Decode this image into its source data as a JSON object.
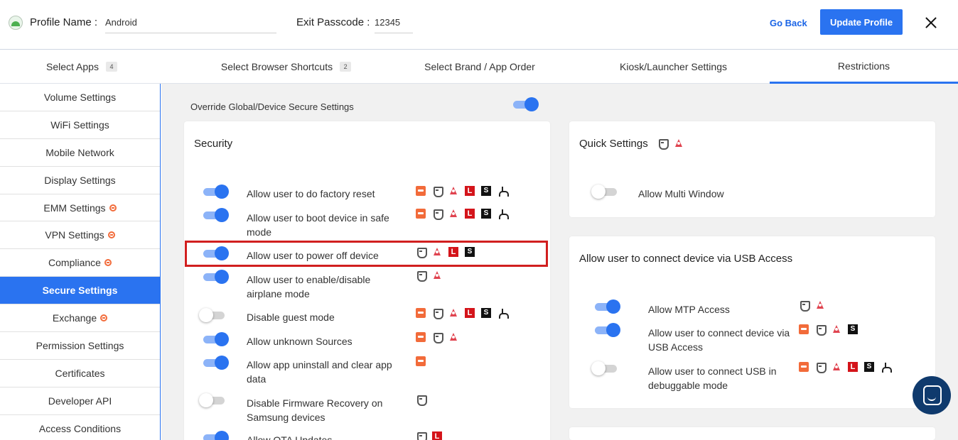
{
  "header": {
    "profile_label": "Profile Name",
    "profile_value": "Android",
    "exit_label": "Exit Passcode",
    "exit_value": "12345",
    "go_back": "Go Back",
    "update_button": "Update Profile"
  },
  "tabs": [
    {
      "label": "Select Apps",
      "count": "4"
    },
    {
      "label": "Select Browser Shortcuts",
      "count": "2"
    },
    {
      "label": "Select Brand / App Order"
    },
    {
      "label": "Kiosk/Launcher Settings"
    },
    {
      "label": "Restrictions",
      "active": true
    }
  ],
  "sidebar": {
    "items": [
      {
        "label": "Volume Settings"
      },
      {
        "label": "WiFi Settings"
      },
      {
        "label": "Mobile Network"
      },
      {
        "label": "Display Settings"
      },
      {
        "label": "EMM Settings",
        "badge": true
      },
      {
        "label": "VPN Settings",
        "badge": true
      },
      {
        "label": "Compliance",
        "badge": true
      },
      {
        "label": "Secure Settings",
        "active": true
      },
      {
        "label": "Exchange",
        "badge": true
      },
      {
        "label": "Permission Settings"
      },
      {
        "label": "Certificates"
      },
      {
        "label": "Developer API"
      },
      {
        "label": "Access Conditions"
      }
    ]
  },
  "override": {
    "label": "Override Global/Device Secure Settings",
    "enabled": true
  },
  "security": {
    "title": "Security",
    "rows": [
      {
        "label": "Allow user to do factory reset",
        "enabled": true,
        "icons": [
          "box-icon",
          "shield-icon",
          "triangle-icon",
          "l-icon",
          "s-icon",
          "fork-icon"
        ]
      },
      {
        "label": "Allow user to boot device in safe mode",
        "enabled": true,
        "icons": [
          "box-icon",
          "shield-icon",
          "triangle-icon",
          "l-icon",
          "s-icon",
          "fork-icon"
        ]
      },
      {
        "label": "Allow user to power off device",
        "enabled": true,
        "icons": [
          "shield-icon",
          "triangle-icon",
          "l-icon",
          "s-icon"
        ]
      },
      {
        "label": "Allow user to enable/disable airplane mode",
        "enabled": true,
        "icons": [
          "shield-icon",
          "triangle-icon"
        ]
      },
      {
        "label": "Disable guest mode",
        "enabled": false,
        "icons": [
          "box-icon",
          "shield-icon",
          "triangle-icon",
          "l-icon",
          "s-icon",
          "fork-icon"
        ]
      },
      {
        "label": "Allow unknown Sources",
        "enabled": true,
        "icons": [
          "box-icon",
          "shield-icon",
          "triangle-icon"
        ]
      },
      {
        "label": "Allow app uninstall and clear app data",
        "enabled": true,
        "icons": [
          "box-icon"
        ]
      },
      {
        "label": "Disable Firmware Recovery on Samsung devices",
        "enabled": false,
        "icons": [
          "shield-icon"
        ]
      },
      {
        "label": "Allow OTA Updates",
        "enabled": true,
        "icons": [
          "shield-icon",
          "l-icon"
        ]
      }
    ]
  },
  "quick_settings": {
    "title": "Quick Settings",
    "rows": [
      {
        "label": "Allow Multi Window",
        "enabled": false
      }
    ]
  },
  "usb": {
    "title": "Allow user to connect device via USB Access",
    "rows": [
      {
        "label": "Allow MTP Access",
        "enabled": true,
        "icons": [
          "shield-icon",
          "triangle-icon"
        ]
      },
      {
        "label": "Allow user to connect device via USB Access",
        "enabled": true,
        "icons": [
          "box-icon",
          "shield-icon",
          "triangle-icon",
          "s-icon"
        ]
      },
      {
        "label": "Allow user to connect USB in debuggable mode",
        "enabled": false,
        "icons": [
          "box-icon",
          "shield-icon",
          "triangle-icon",
          "l-icon",
          "s-icon",
          "fork-icon"
        ]
      }
    ]
  }
}
